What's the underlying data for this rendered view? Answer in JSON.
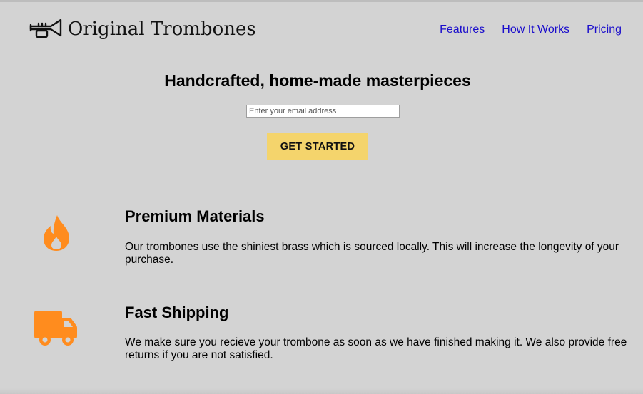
{
  "header": {
    "logo_icon": "trumpet-icon",
    "brand": "Original Trombones",
    "nav": [
      "Features",
      "How It Works",
      "Pricing"
    ],
    "link_color": "#1a0dcc"
  },
  "hero": {
    "title": "Handcrafted, home-made masterpieces",
    "email_placeholder": "Enter your email address",
    "cta_label": "GET STARTED",
    "cta_color": "#f4d46c"
  },
  "features": [
    {
      "icon": "fire-icon",
      "title": "Premium Materials",
      "text": "Our trombones use the shiniest brass which is sourced locally. This will increase the longevity of your purchase."
    },
    {
      "icon": "truck-icon",
      "title": "Fast Shipping",
      "text": "We make sure you recieve your trombone as soon as we have finished making it. We also provide free returns if you are not satisfied."
    }
  ],
  "colors": {
    "background": "#d3d3d3",
    "icon_accent": "#ff8c1e"
  }
}
